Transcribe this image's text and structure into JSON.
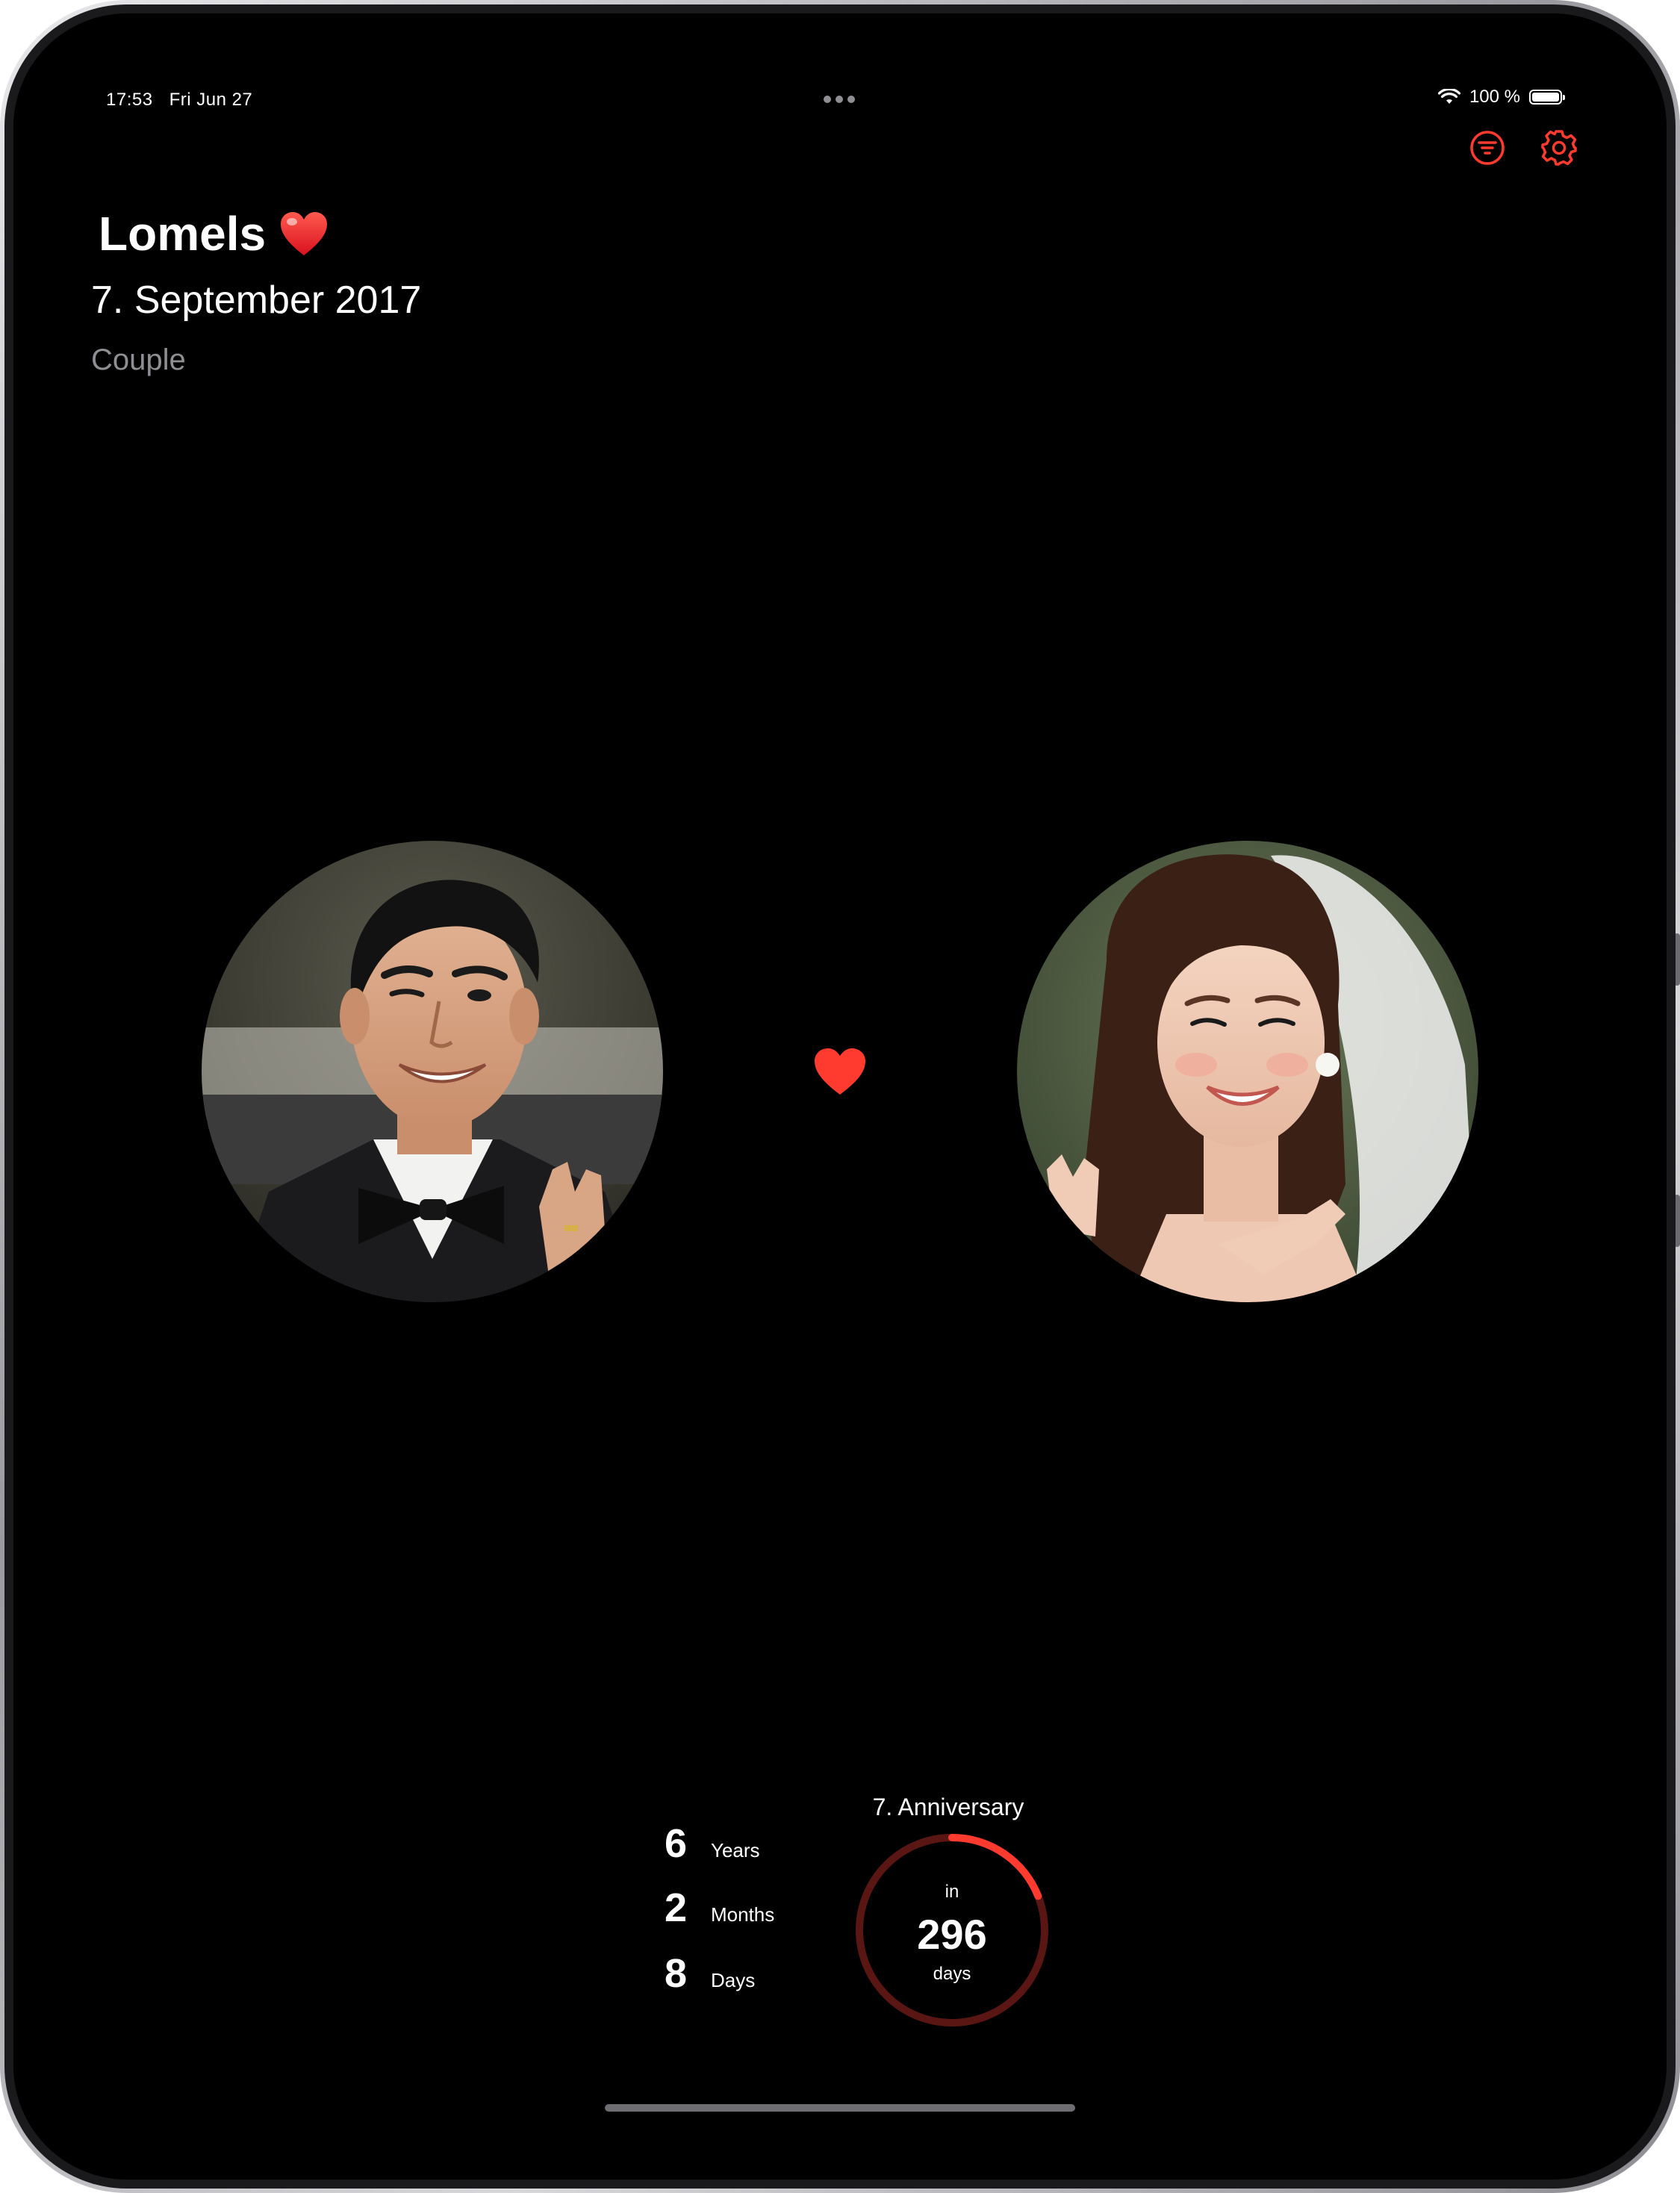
{
  "status_bar": {
    "time": "17:53",
    "date": "Fri Jun 27",
    "battery": "100 %"
  },
  "toolbar": {
    "filter_icon": "filter-circle-icon",
    "settings_icon": "gear-icon",
    "accent_color": "#ff3b30"
  },
  "header": {
    "title": "Lomels",
    "title_emoji": "heart-icon",
    "date": "7. September 2017",
    "category": "Couple"
  },
  "partners": {
    "left_photo": "groom-photo",
    "right_photo": "bride-photo",
    "center_icon": "heart-icon"
  },
  "duration": {
    "years_value": "6",
    "years_label": "Years",
    "months_value": "2",
    "months_label": "Months",
    "days_value": "8",
    "days_label": "Days"
  },
  "anniversary": {
    "label": "7. Anniversary",
    "prefix": "in",
    "count": "296",
    "unit": "days",
    "progress_fraction": 0.19
  }
}
